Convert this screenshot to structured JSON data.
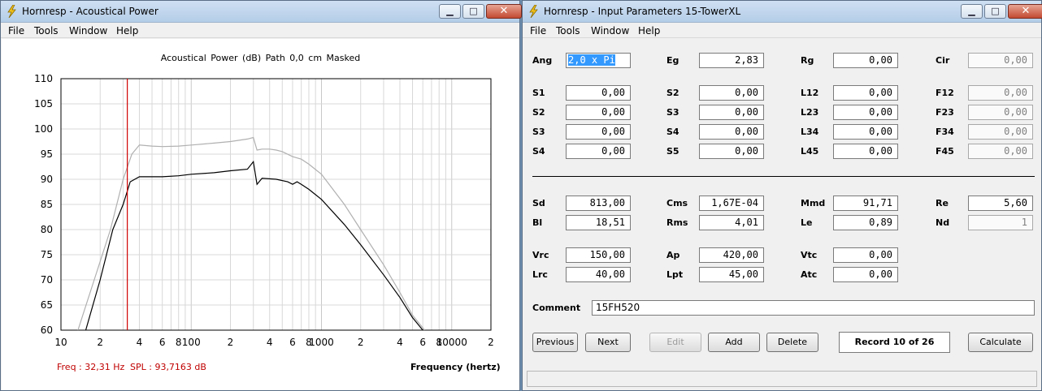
{
  "window1": {
    "title": "Hornresp - Acoustical Power",
    "menu": [
      "File",
      "Tools",
      "Window",
      "Help"
    ],
    "chart_title": "Acoustical Power (dB)   Path 0,0 cm    Masked",
    "freq_readout": "Freq : 32,31 Hz",
    "spl_readout": "SPL : 93,7163 dB",
    "x_axis_label": "Frequency (hertz)"
  },
  "window2": {
    "title": "Hornresp - Input Parameters   15-TowerXL",
    "menu": [
      "File",
      "Tools",
      "Window",
      "Help"
    ],
    "params": {
      "ang": {
        "label": "Ang",
        "value": "2,0 x Pi"
      },
      "eg": {
        "label": "Eg",
        "value": "2,83"
      },
      "rg": {
        "label": "Rg",
        "value": "0,00"
      },
      "cir": {
        "label": "Cir",
        "value": "0,00"
      },
      "s1a": {
        "label": "S1",
        "value": "0,00"
      },
      "s2a": {
        "label": "S2",
        "value": "0,00"
      },
      "l12": {
        "label": "L12",
        "value": "0,00"
      },
      "f12": {
        "label": "F12",
        "value": "0,00"
      },
      "s2b": {
        "label": "S2",
        "value": "0,00"
      },
      "s3a": {
        "label": "S3",
        "value": "0,00"
      },
      "l23": {
        "label": "L23",
        "value": "0,00"
      },
      "f23": {
        "label": "F23",
        "value": "0,00"
      },
      "s3b": {
        "label": "S3",
        "value": "0,00"
      },
      "s4a": {
        "label": "S4",
        "value": "0,00"
      },
      "l34": {
        "label": "L34",
        "value": "0,00"
      },
      "f34": {
        "label": "F34",
        "value": "0,00"
      },
      "s4b": {
        "label": "S4",
        "value": "0,00"
      },
      "s5": {
        "label": "S5",
        "value": "0,00"
      },
      "l45": {
        "label": "L45",
        "value": "0,00"
      },
      "f45": {
        "label": "F45",
        "value": "0,00"
      },
      "sd": {
        "label": "Sd",
        "value": "813,00"
      },
      "cms": {
        "label": "Cms",
        "value": "1,67E-04"
      },
      "mmd": {
        "label": "Mmd",
        "value": "91,71"
      },
      "re": {
        "label": "Re",
        "value": "5,60"
      },
      "bl": {
        "label": "Bl",
        "value": "18,51"
      },
      "rms": {
        "label": "Rms",
        "value": "4,01"
      },
      "le": {
        "label": "Le",
        "value": "0,89"
      },
      "nd": {
        "label": "Nd",
        "value": "1"
      },
      "vrc": {
        "label": "Vrc",
        "value": "150,00"
      },
      "ap": {
        "label": "Ap",
        "value": "420,00"
      },
      "vtc": {
        "label": "Vtc",
        "value": "0,00"
      },
      "lrc": {
        "label": "Lrc",
        "value": "40,00"
      },
      "lpt": {
        "label": "Lpt",
        "value": "45,00"
      },
      "atc": {
        "label": "Atc",
        "value": "0,00"
      }
    },
    "comment_label": "Comment",
    "comment_value": "15FH520",
    "buttons": {
      "previous": "Previous",
      "next": "Next",
      "edit": "Edit",
      "add": "Add",
      "delete": "Delete",
      "calculate": "Calculate"
    },
    "record": "Record 10 of 26"
  },
  "colors": {
    "trace_main": "#000000",
    "trace_masked": "#b0b0b0",
    "cursor": "#d00000",
    "grid": "#d8d8d8"
  },
  "chart_data": {
    "type": "line",
    "title": "Acoustical Power (dB)   Path 0,0 cm    Masked",
    "xlabel": "Frequency (hertz)",
    "ylabel": "",
    "x_scale": "log",
    "xlim": [
      10,
      20000
    ],
    "ylim": [
      60,
      110
    ],
    "yticks": [
      60,
      65,
      70,
      75,
      80,
      85,
      90,
      95,
      100,
      105,
      110
    ],
    "xtick_labels": [
      {
        "x": 10,
        "label": "10"
      },
      {
        "x": 20,
        "label": "2"
      },
      {
        "x": 40,
        "label": "4"
      },
      {
        "x": 60,
        "label": "6"
      },
      {
        "x": 80,
        "label": "8"
      },
      {
        "x": 100,
        "label": "100"
      },
      {
        "x": 200,
        "label": "2"
      },
      {
        "x": 400,
        "label": "4"
      },
      {
        "x": 600,
        "label": "6"
      },
      {
        "x": 800,
        "label": "8"
      },
      {
        "x": 1000,
        "label": "1000"
      },
      {
        "x": 2000,
        "label": "2"
      },
      {
        "x": 4000,
        "label": "4"
      },
      {
        "x": 6000,
        "label": "6"
      },
      {
        "x": 8000,
        "label": "8"
      },
      {
        "x": 10000,
        "label": "10000"
      },
      {
        "x": 20000,
        "label": "2"
      }
    ],
    "grid": true,
    "cursor_x": 32.31,
    "series": [
      {
        "values": [
          [
            13.5,
            60
          ],
          [
            18,
            70
          ],
          [
            24,
            80
          ],
          [
            30,
            90
          ],
          [
            35,
            95
          ],
          [
            40,
            96.8
          ],
          [
            50,
            96.6
          ],
          [
            60,
            96.5
          ],
          [
            80,
            96.6
          ],
          [
            100,
            96.8
          ],
          [
            150,
            97.2
          ],
          [
            200,
            97.5
          ],
          [
            270,
            98.0
          ],
          [
            300,
            98.3
          ],
          [
            320,
            95.8
          ],
          [
            350,
            96.0
          ],
          [
            400,
            96.0
          ],
          [
            450,
            95.8
          ],
          [
            500,
            95.5
          ],
          [
            600,
            94.5
          ],
          [
            700,
            94.0
          ],
          [
            800,
            93.0
          ],
          [
            1000,
            91.0
          ],
          [
            1500,
            85.0
          ],
          [
            2000,
            80.0
          ],
          [
            3000,
            73.0
          ],
          [
            4000,
            67.5
          ],
          [
            5000,
            63.0
          ],
          [
            6200,
            60
          ]
        ]
      },
      {
        "values": [
          [
            15.5,
            60
          ],
          [
            20,
            70
          ],
          [
            25,
            80
          ],
          [
            30,
            85
          ],
          [
            34,
            89.5
          ],
          [
            40,
            90.5
          ],
          [
            60,
            90.5
          ],
          [
            80,
            90.7
          ],
          [
            100,
            91.0
          ],
          [
            150,
            91.3
          ],
          [
            200,
            91.7
          ],
          [
            270,
            92.0
          ],
          [
            300,
            93.5
          ],
          [
            320,
            89.0
          ],
          [
            350,
            90.2
          ],
          [
            450,
            90.0
          ],
          [
            550,
            89.5
          ],
          [
            600,
            89.0
          ],
          [
            650,
            89.5
          ],
          [
            700,
            89.0
          ],
          [
            800,
            88.0
          ],
          [
            1000,
            86.0
          ],
          [
            1500,
            81.0
          ],
          [
            2000,
            77.0
          ],
          [
            3000,
            71.0
          ],
          [
            4000,
            66.5
          ],
          [
            5000,
            62.5
          ],
          [
            6000,
            60
          ]
        ]
      }
    ]
  }
}
